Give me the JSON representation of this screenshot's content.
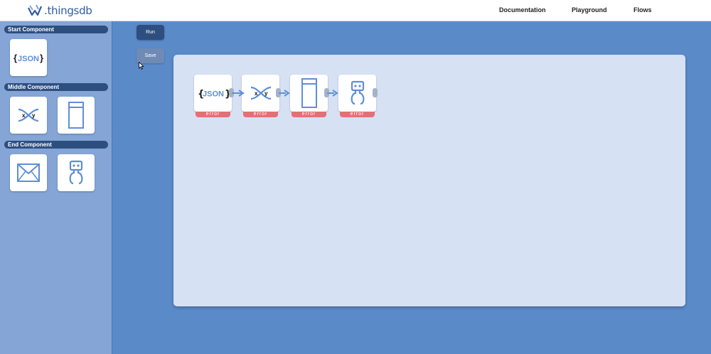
{
  "app": {
    "logo_text": ".thingsdb"
  },
  "nav": {
    "links": [
      "Documentation",
      "Playground",
      "Flows"
    ]
  },
  "sidebar": {
    "sections": [
      {
        "title": "Start Component",
        "items": [
          {
            "icon": "json-icon",
            "label": "{JSON}"
          }
        ]
      },
      {
        "title": "Middle Component",
        "items": [
          {
            "icon": "xy-transform-icon",
            "x": "x",
            "y": "y"
          },
          {
            "icon": "document-icon"
          }
        ]
      },
      {
        "title": "End Component",
        "items": [
          {
            "icon": "mail-icon"
          },
          {
            "icon": "robot-icon"
          }
        ]
      }
    ]
  },
  "toolbar": {
    "run_label": "Run",
    "save_label": "Save"
  },
  "flow": {
    "nodes": [
      {
        "icon": "json-icon",
        "status": "error"
      },
      {
        "icon": "xy-transform-icon",
        "status": "error"
      },
      {
        "icon": "document-icon",
        "status": "error"
      },
      {
        "icon": "robot-icon",
        "status": "error"
      }
    ]
  },
  "colors": {
    "accent": "#2d4f80",
    "background": "#5b8ac9",
    "sidebar": "#84a5d6",
    "canvas": "#d6e1f4",
    "icon": "#5e8fd6",
    "error": "#e07176"
  }
}
